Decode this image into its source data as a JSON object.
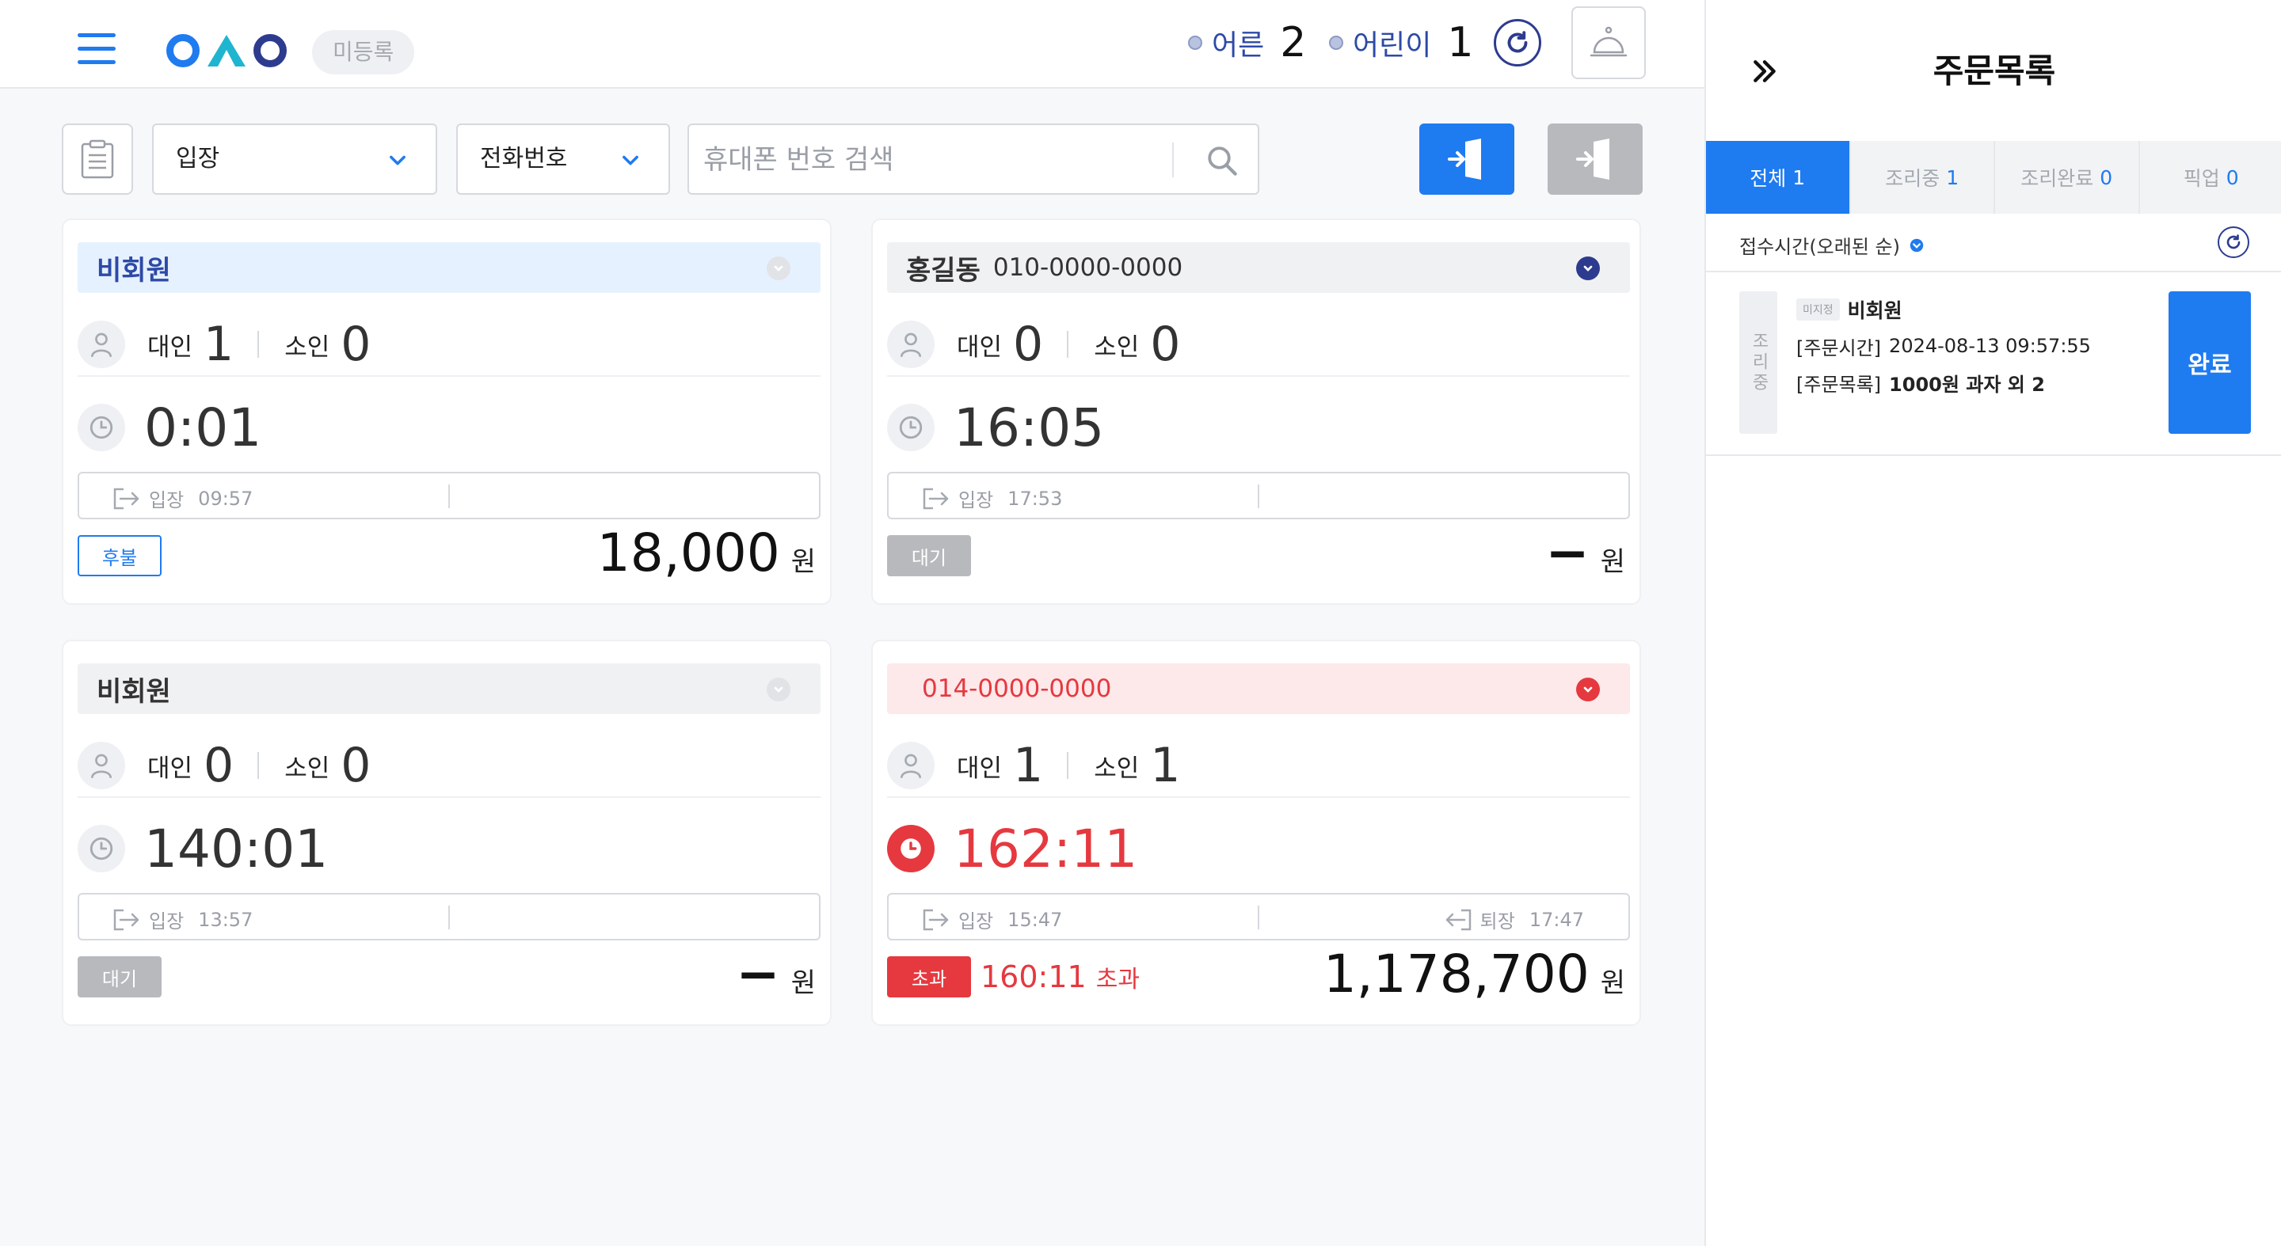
{
  "header": {
    "unregistered_label": "미등록",
    "adult_label": "어른",
    "adult_count": "2",
    "child_label": "어린이",
    "child_count": "1"
  },
  "toolbar": {
    "filter_select": "입장",
    "search_type_select": "전화번호",
    "search_placeholder": "휴대폰 번호 검색"
  },
  "cards": [
    {
      "title": "비회원",
      "phone": "",
      "adult_label": "대인",
      "adult_count": "1",
      "child_label": "소인",
      "child_count": "0",
      "elapsed": "0:01",
      "entry_label": "입장",
      "entry_time": "09:57",
      "exit_label": "",
      "exit_time": "",
      "status": "후불",
      "amount": "18,000",
      "currency": "원"
    },
    {
      "title": "홍길동",
      "phone": "010-0000-0000",
      "adult_label": "대인",
      "adult_count": "0",
      "child_label": "소인",
      "child_count": "0",
      "elapsed": "16:05",
      "entry_label": "입장",
      "entry_time": "17:53",
      "exit_label": "",
      "exit_time": "",
      "status": "대기",
      "amount": "−",
      "currency": "원"
    },
    {
      "title": "비회원",
      "phone": "",
      "adult_label": "대인",
      "adult_count": "0",
      "child_label": "소인",
      "child_count": "0",
      "elapsed": "140:01",
      "entry_label": "입장",
      "entry_time": "13:57",
      "exit_label": "",
      "exit_time": "",
      "status": "대기",
      "amount": "−",
      "currency": "원"
    },
    {
      "title": "014-0000-0000",
      "phone": "",
      "adult_label": "대인",
      "adult_count": "1",
      "child_label": "소인",
      "child_count": "1",
      "elapsed": "162:11",
      "entry_label": "입장",
      "entry_time": "15:47",
      "exit_label": "퇴장",
      "exit_time": "17:47",
      "status": "초과",
      "over_time": "160:11",
      "over_label": "초과",
      "amount": "1,178,700",
      "currency": "원"
    }
  ],
  "panel": {
    "title": "주문목록",
    "tabs": [
      {
        "label": "전체",
        "count": "1"
      },
      {
        "label": "조리중",
        "count": "1"
      },
      {
        "label": "조리완료",
        "count": "0"
      },
      {
        "label": "픽업",
        "count": "0"
      }
    ],
    "sort_label": "접수시간(오래된 순)",
    "order": {
      "state": "조리중",
      "badge": "미지정",
      "name": "비회원",
      "time_label": "[주문시간]",
      "time": "2024-08-13 09:57:55",
      "items_label": "[주문목록]",
      "items": "1000원 과자 외 2",
      "done_label": "완료"
    }
  },
  "colors": {
    "primary": "#1f7bf0",
    "navy": "#2d3b8f",
    "danger": "#e5393f",
    "card1_head": "#e6f1ff",
    "card4_head": "#fde8ea"
  }
}
